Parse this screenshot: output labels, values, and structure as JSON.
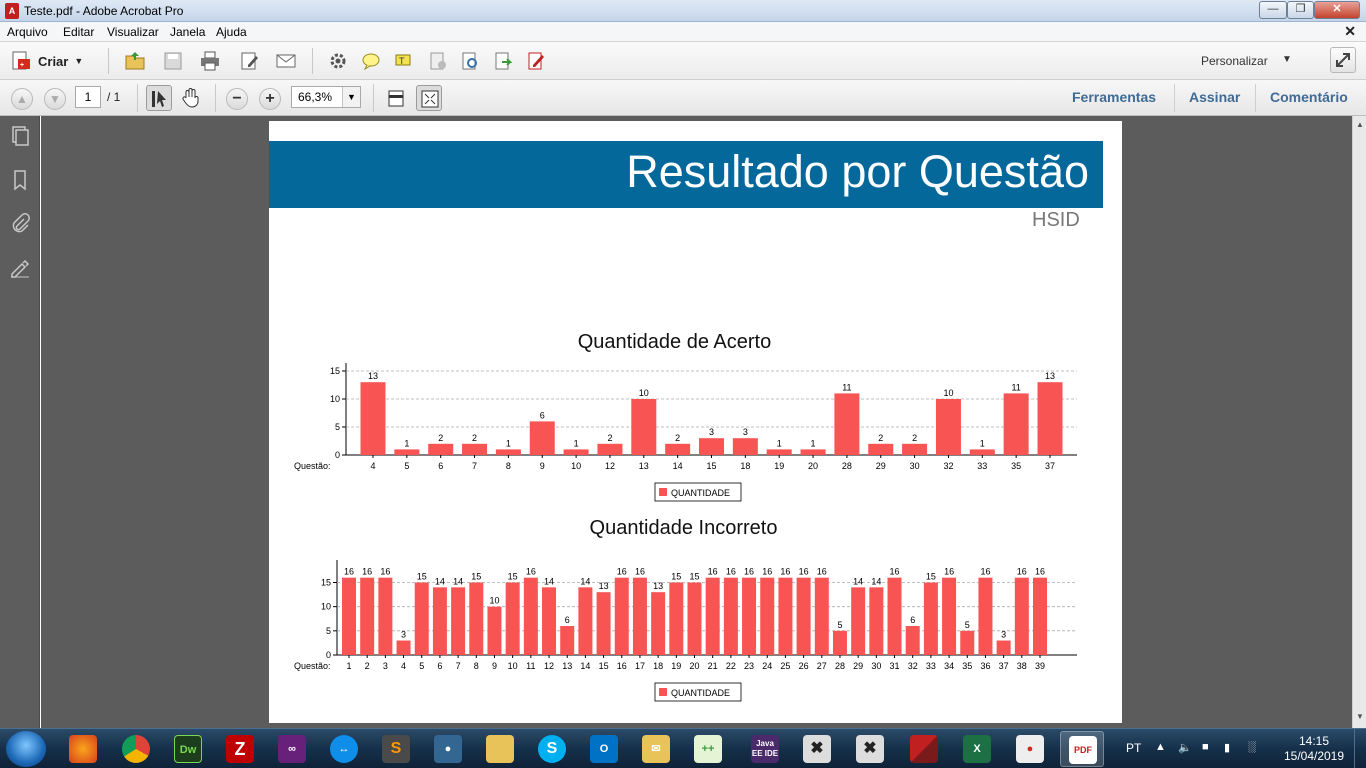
{
  "window": {
    "title": "Teste.pdf - Adobe Acrobat Pro"
  },
  "menu": [
    "Arquivo",
    "Editar",
    "Visualizar",
    "Janela",
    "Ajuda"
  ],
  "toolbar": {
    "create_label": "Criar",
    "customize_label": "Personalizar"
  },
  "navigation": {
    "page_current": "1",
    "page_total": "/ 1",
    "zoom": "66,3%"
  },
  "panels": {
    "tools": "Ferramentas",
    "sign": "Assinar",
    "comment": "Comentário"
  },
  "document": {
    "title": "Resultado por Questão",
    "subtitle": "HSID",
    "banner_color": "#05689b",
    "bar_color": "#f95454"
  },
  "chart_data": [
    {
      "type": "bar",
      "title": "Quantidade de Acerto",
      "xlabel": "Questão:",
      "categories": [
        "4",
        "5",
        "6",
        "7",
        "8",
        "9",
        "10",
        "12",
        "13",
        "14",
        "15",
        "18",
        "19",
        "20",
        "28",
        "29",
        "30",
        "32",
        "33",
        "35",
        "37"
      ],
      "series": [
        {
          "name": "QUANTIDADE",
          "values": [
            13,
            1,
            2,
            2,
            1,
            6,
            1,
            2,
            10,
            2,
            3,
            3,
            1,
            1,
            11,
            2,
            2,
            10,
            1,
            11,
            13
          ]
        }
      ],
      "ylim": [
        0,
        15
      ],
      "yticks": [
        0,
        5,
        10,
        15
      ],
      "grid": true,
      "legend": "bottom-center"
    },
    {
      "type": "bar",
      "title": "Quantidade Incorreto",
      "xlabel": "Questão:",
      "categories": [
        "1",
        "2",
        "3",
        "4",
        "5",
        "6",
        "7",
        "8",
        "9",
        "10",
        "11",
        "12",
        "13",
        "14",
        "15",
        "16",
        "17",
        "18",
        "19",
        "20",
        "21",
        "22",
        "23",
        "24",
        "25",
        "26",
        "27",
        "28",
        "29",
        "30",
        "31",
        "32",
        "33",
        "34",
        "35",
        "36",
        "37",
        "38",
        "39"
      ],
      "series": [
        {
          "name": "QUANTIDADE",
          "values": [
            16,
            16,
            16,
            3,
            15,
            14,
            14,
            15,
            10,
            15,
            16,
            14,
            6,
            14,
            13,
            16,
            16,
            13,
            15,
            15,
            16,
            16,
            16,
            16,
            16,
            16,
            16,
            5,
            14,
            14,
            16,
            6,
            15,
            16,
            5,
            16,
            3,
            16,
            16
          ]
        }
      ],
      "ylim": [
        0,
        18
      ],
      "yticks": [
        0,
        5,
        10,
        15
      ],
      "grid": true,
      "legend": "bottom-center"
    }
  ],
  "taskbar": {
    "language": "PT",
    "time": "14:15",
    "date": "15/04/2019"
  }
}
